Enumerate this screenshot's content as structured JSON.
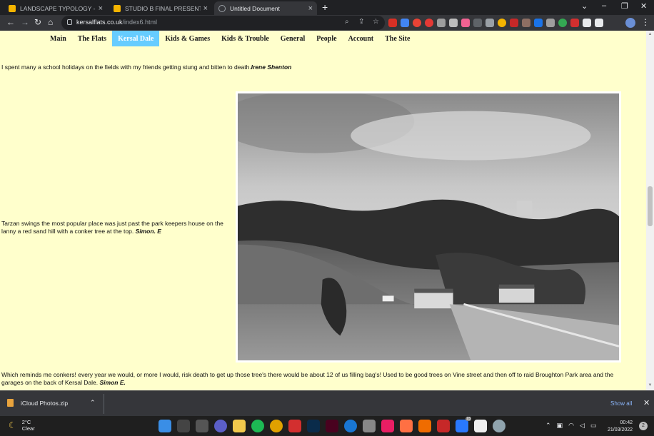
{
  "browser": {
    "tabs": [
      {
        "title": "LANDSCAPE TYPOLOGY - Google",
        "favicon": "slides-icon",
        "active": false
      },
      {
        "title": "STUDIO B FINAL PRESENTATION",
        "favicon": "slides-icon",
        "active": false
      },
      {
        "title": "Untitled Document",
        "favicon": "globe-icon",
        "active": true
      }
    ],
    "url_host": "kersalflats.co.uk",
    "url_path": "/index6.html"
  },
  "site": {
    "nav": [
      {
        "label": "Main"
      },
      {
        "label": "The Flats"
      },
      {
        "label": "Kersal Dale",
        "active": true
      },
      {
        "label": "Kids & Games"
      },
      {
        "label": "Kids & Trouble"
      },
      {
        "label": "General"
      },
      {
        "label": "People"
      },
      {
        "label": "Account"
      },
      {
        "label": "The Site"
      }
    ],
    "memories": [
      {
        "text": "I spent many a school holidays on the fields with my friends getting stung and bitten to death.",
        "author": "Irene Shenton"
      },
      {
        "text": "Tarzan swings the most popular place was just past the park keepers house on the lanny a red sand hill with a conker tree at the top. ",
        "author": "Simon. E"
      },
      {
        "text": "Which reminds me conkers! every year we would, or more I would, risk death to get up those tree's there would be about 12 of us filling bag's! Used to be good trees on Vine street and then off to raid Broughton Park area and the garages on the back of Kersal Dale. ",
        "author": "Simon E."
      }
    ]
  },
  "downloads": {
    "file": "iCloud Photos.zip",
    "show_all": "Show all"
  },
  "taskbar": {
    "temp": "2°C",
    "condition": "Clear",
    "time": "00:42",
    "date": "21/03/2022",
    "notifications": "2"
  },
  "colors": {
    "page_bg": "#ffffcc",
    "nav_active": "#66ccff",
    "chrome_dark": "#202124",
    "chrome_toolbar": "#35363a"
  }
}
